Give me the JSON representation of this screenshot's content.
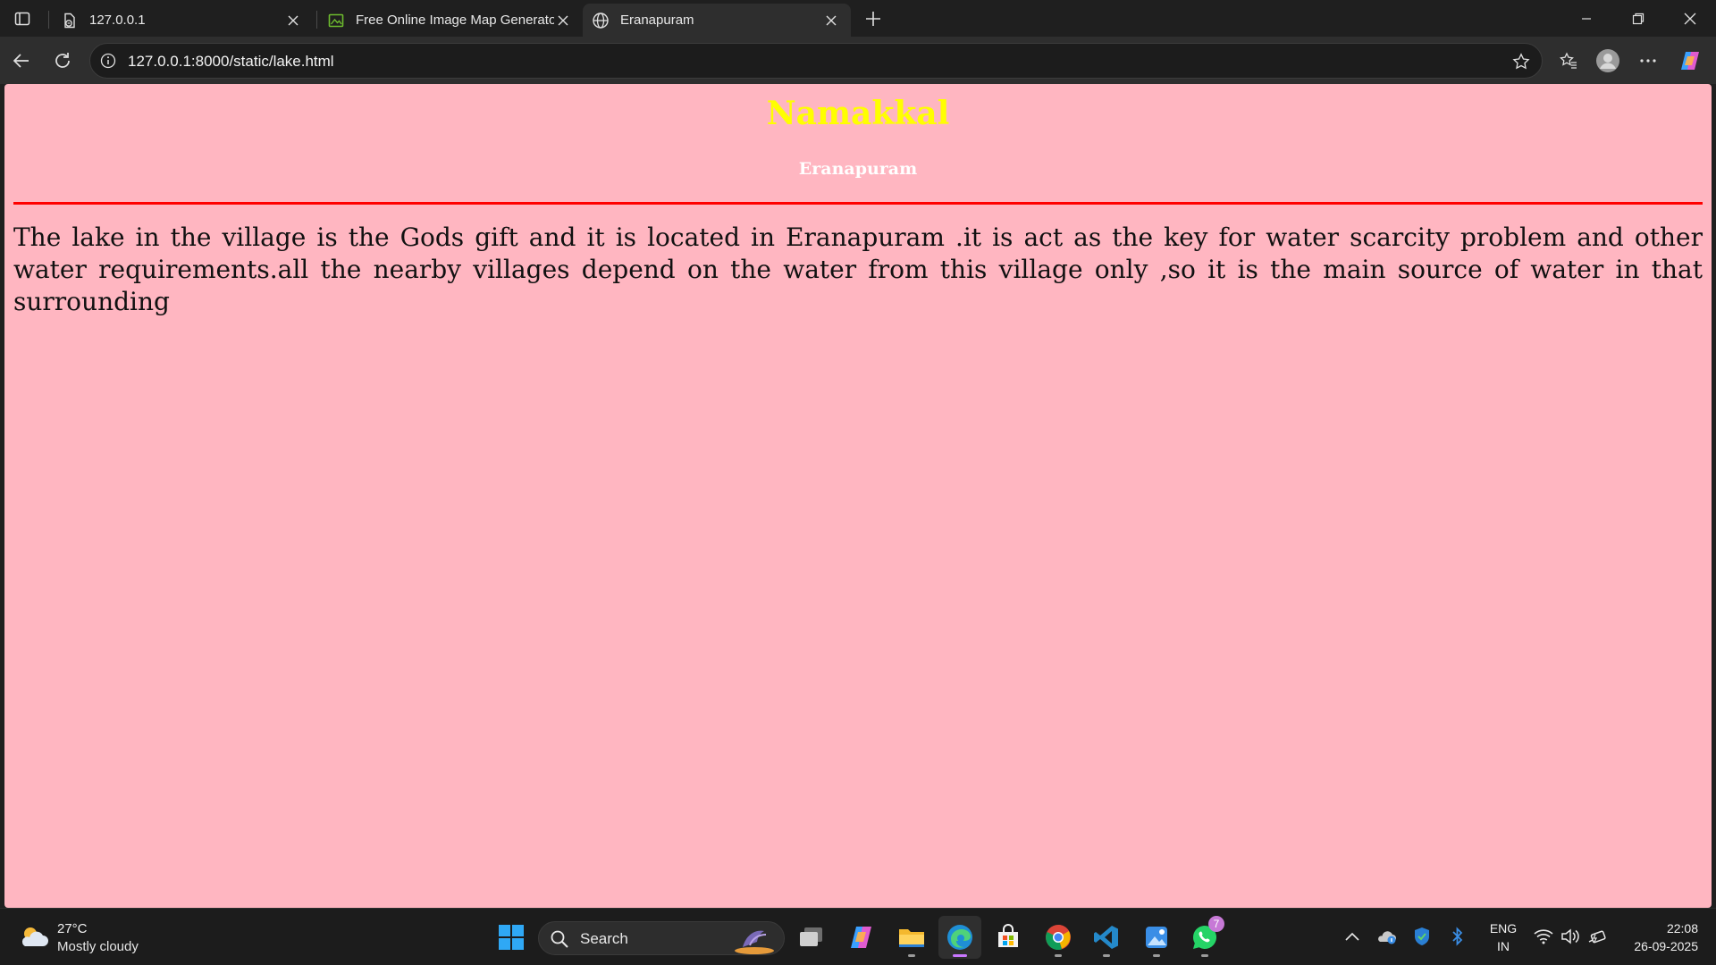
{
  "browser": {
    "tabs": [
      {
        "title": "127.0.0.1",
        "icon": "file-sync-icon"
      },
      {
        "title": "Free Online Image Map Generator",
        "icon": "image-map-icon"
      },
      {
        "title": "Eranapuram",
        "icon": "globe-icon",
        "active": true
      }
    ],
    "url": "127.0.0.1:8000/static/lake.html"
  },
  "page": {
    "heading": "Namakkal",
    "subheading": "Eranapuram",
    "paragraph": "The lake in the village is the Gods gift and it is located in Eranapuram .it is act as the key for water scarcity problem and other water requirements.all the nearby villages depend on the water from this village only ,so it is the main source of water in that surrounding",
    "colors": {
      "background": "#ffb6c1",
      "heading": "#ffff00",
      "subheading": "#ffffff",
      "rule": "#ff0000"
    }
  },
  "taskbar": {
    "weather": {
      "temp": "27°C",
      "condition": "Mostly cloudy"
    },
    "search_label": "Search",
    "whatsapp_badge": "7",
    "lang": {
      "line1": "ENG",
      "line2": "IN"
    },
    "clock": {
      "time": "22:08",
      "date": "26-09-2025"
    }
  }
}
